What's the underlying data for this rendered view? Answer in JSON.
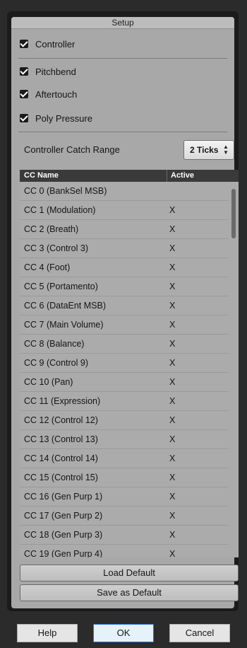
{
  "panel": {
    "title": "Setup"
  },
  "options": {
    "controller": {
      "label": "Controller",
      "checked": true
    },
    "pitchbend": {
      "label": "Pitchbend",
      "checked": true
    },
    "aftertouch": {
      "label": "Aftertouch",
      "checked": true
    },
    "poly_pressure": {
      "label": "Poly Pressure",
      "checked": true
    }
  },
  "catch_range": {
    "label": "Controller Catch Range",
    "value": "2 Ticks"
  },
  "table": {
    "columns": [
      "CC Name",
      "Active"
    ],
    "rows": [
      {
        "name": "CC 0  (BankSel MSB)",
        "active": ""
      },
      {
        "name": "CC 1  (Modulation)",
        "active": "X"
      },
      {
        "name": "CC 2  (Breath)",
        "active": "X"
      },
      {
        "name": "CC 3  (Control 3)",
        "active": "X"
      },
      {
        "name": "CC 4  (Foot)",
        "active": "X"
      },
      {
        "name": "CC 5  (Portamento)",
        "active": "X"
      },
      {
        "name": "CC 6  (DataEnt MSB)",
        "active": "X"
      },
      {
        "name": "CC 7  (Main Volume)",
        "active": "X"
      },
      {
        "name": "CC 8  (Balance)",
        "active": "X"
      },
      {
        "name": "CC 9  (Control 9)",
        "active": "X"
      },
      {
        "name": "CC 10  (Pan)",
        "active": "X"
      },
      {
        "name": "CC 11  (Expression)",
        "active": "X"
      },
      {
        "name": "CC 12  (Control 12)",
        "active": "X"
      },
      {
        "name": "CC 13  (Control 13)",
        "active": "X"
      },
      {
        "name": "CC 14  (Control 14)",
        "active": "X"
      },
      {
        "name": "CC 15  (Control 15)",
        "active": "X"
      },
      {
        "name": "CC 16  (Gen Purp 1)",
        "active": "X"
      },
      {
        "name": "CC 17  (Gen Purp 2)",
        "active": "X"
      },
      {
        "name": "CC 18  (Gen Purp 3)",
        "active": "X"
      },
      {
        "name": "CC 19  (Gen Purp 4)",
        "active": "X"
      }
    ]
  },
  "buttons": {
    "load_default": "Load Default",
    "save_as_default": "Save as Default",
    "help": "Help",
    "ok": "OK",
    "cancel": "Cancel"
  }
}
